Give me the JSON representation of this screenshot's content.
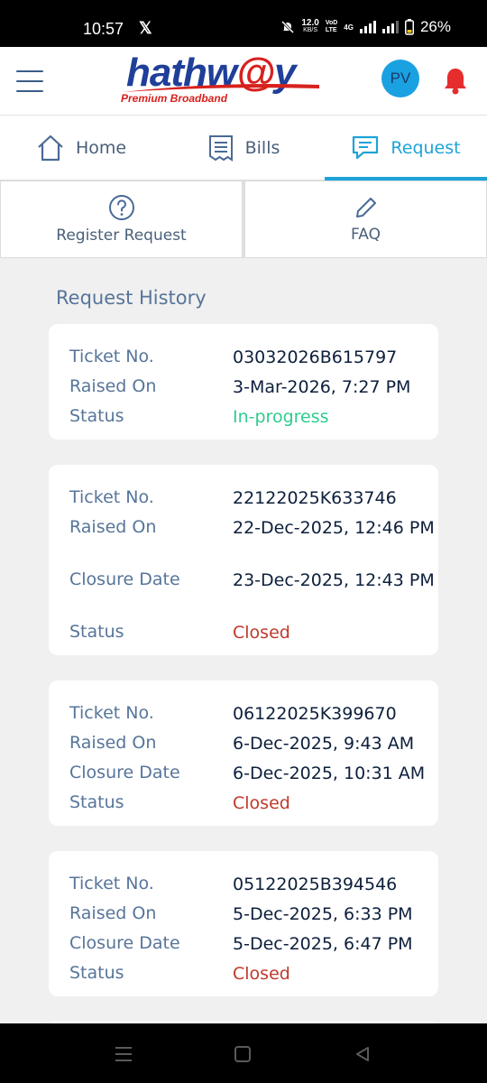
{
  "status_bar": {
    "time": "10:57",
    "notif_icon": "x-logo-icon",
    "net_speed_value": "12.0",
    "net_speed_unit": "KB/S",
    "volte_top": "VoD",
    "volte_bottom": "LTE",
    "network": "4G",
    "battery": "26%"
  },
  "header": {
    "brand_name_1": "hathw",
    "brand_name_at": "@",
    "brand_name_2": "y",
    "brand_tagline": "Premium Broadband",
    "avatar_initials": "PV",
    "accent_color": "#1ea3d8"
  },
  "tabs": [
    {
      "label": "Home",
      "icon": "home-icon",
      "active": false
    },
    {
      "label": "Bills",
      "icon": "receipt-icon",
      "active": false
    },
    {
      "label": "Request",
      "icon": "chat-icon",
      "active": true
    }
  ],
  "actions": [
    {
      "label": "Register Request",
      "icon": "question-circle-icon"
    },
    {
      "label": "FAQ",
      "icon": "pencil-icon"
    }
  ],
  "section_title": "Request History",
  "labels": {
    "ticket": "Ticket No.",
    "raised": "Raised On",
    "closure": "Closure Date",
    "status": "Status"
  },
  "requests": [
    {
      "ticket": "03032026B615797",
      "raised": "3-Mar-2026, 7:27 PM",
      "status": "In-progress"
    },
    {
      "ticket": "22122025K633746",
      "raised": "22-Dec-2025, 12:46 PM",
      "closure": "23-Dec-2025, 12:43 PM",
      "status": "Closed"
    },
    {
      "ticket": "06122025K399670",
      "raised": "6-Dec-2025, 9:43 AM",
      "closure": "6-Dec-2025, 10:31 AM",
      "status": "Closed"
    },
    {
      "ticket": "05122025B394546",
      "raised": "5-Dec-2025, 6:33 PM",
      "closure": "5-Dec-2025, 6:47 PM",
      "status": "Closed"
    }
  ],
  "status_colors": {
    "in_progress": "#2ecc8f",
    "closed": "#c0392b"
  },
  "nav_bar": [
    "menu-icon",
    "home-square-icon",
    "back-triangle-icon"
  ]
}
